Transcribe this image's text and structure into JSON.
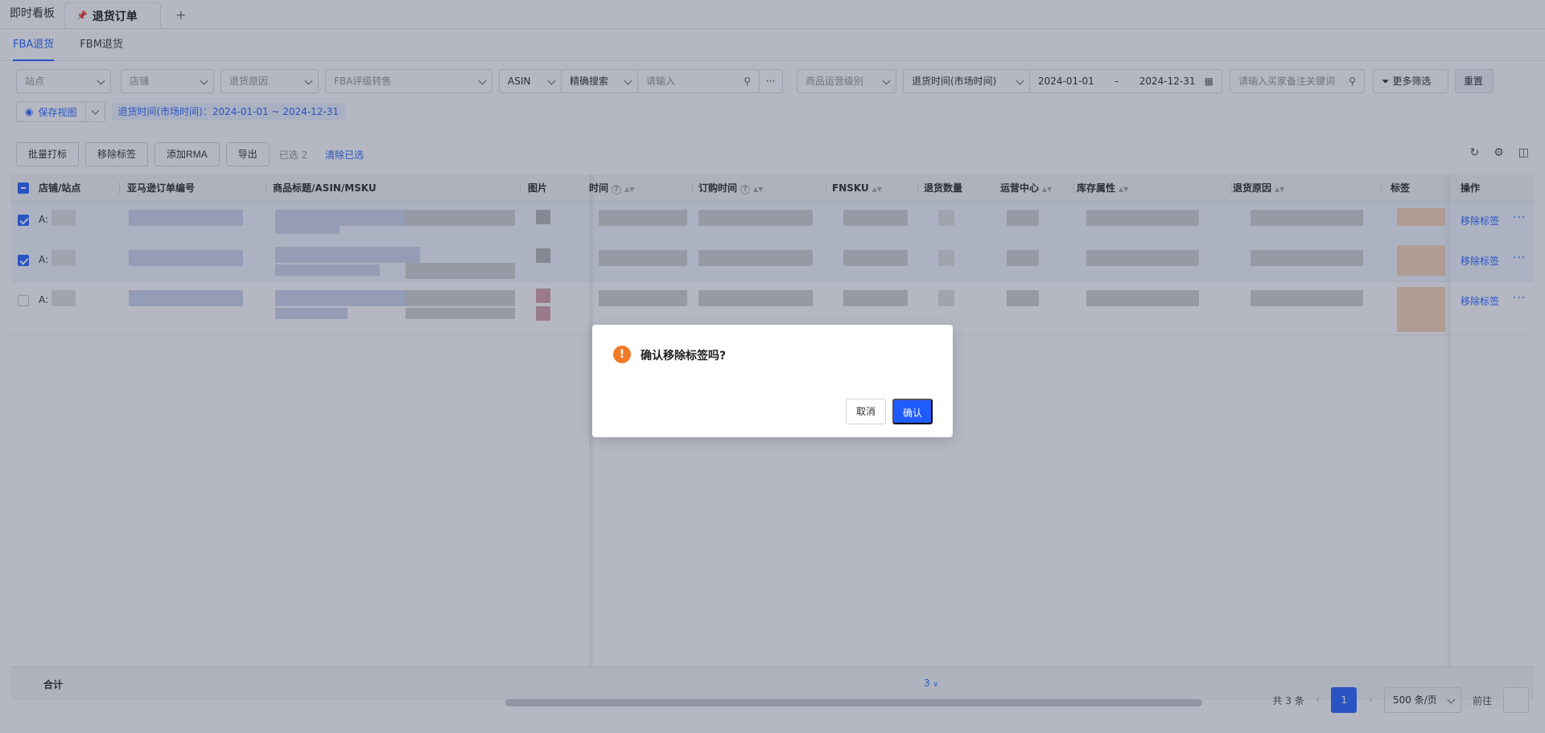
{
  "top_tabs": {
    "dashboard": "即时看板",
    "active": "退货订单",
    "add": "+"
  },
  "sub_tabs": [
    {
      "label": "FBA退货",
      "active": true
    },
    {
      "label": "FBM退货",
      "active": false
    }
  ],
  "filters": {
    "site": "站点",
    "shop": "店铺",
    "reason": "退货原因",
    "fba_grade": "FBA评级转售",
    "asin_type": "ASIN",
    "search_mode": "精确搜索",
    "search_placeholder": "请输入",
    "ops_level": "商品运营级别",
    "time_type": "退货时间(市场时间)",
    "date_start": "2024-01-01",
    "date_sep": "-",
    "date_end": "2024-12-31",
    "buyer_note_placeholder": "请输入买家备注关键词",
    "more_filter": "更多筛选",
    "reset": "重置"
  },
  "view": {
    "save_view": "保存视图",
    "condition": "退货时间(市场时间)：2024-01-01 ~ 2024-12-31"
  },
  "toolbar": {
    "batch_tag": "批量打标",
    "remove_tag": "移除标签",
    "add_rma": "添加RMA",
    "export": "导出",
    "selected": "已选 2",
    "clear_selected": "清除已选"
  },
  "table": {
    "headers": {
      "shop_site": "店铺/站点",
      "order_no": "亚马逊订单编号",
      "product": "商品标题/ASIN/MSKU",
      "image": "图片",
      "return_time": "时间",
      "order_time": "订购时间",
      "fnsku": "FNSKU",
      "qty": "退货数量",
      "fc": "运营中心",
      "stock_attr": "库存属性",
      "reason": "退货原因",
      "tag": "标签",
      "action": "操作"
    },
    "rows": [
      {
        "shop": "A:",
        "checked": true,
        "action": "移除标签",
        "more": "···"
      },
      {
        "shop": "A:",
        "checked": true,
        "action": "移除标签",
        "more": "···"
      },
      {
        "shop": "A:",
        "checked": false,
        "action": "移除标签",
        "more": "···"
      }
    ],
    "summary_label": "合计",
    "summary_qty": "3"
  },
  "pagination": {
    "total": "共 3 条",
    "page": "1",
    "page_size": "500 条/页",
    "goto": "前往"
  },
  "dialog": {
    "icon": "!",
    "title": "确认移除标签吗?",
    "cancel": "取消",
    "confirm": "确认"
  }
}
